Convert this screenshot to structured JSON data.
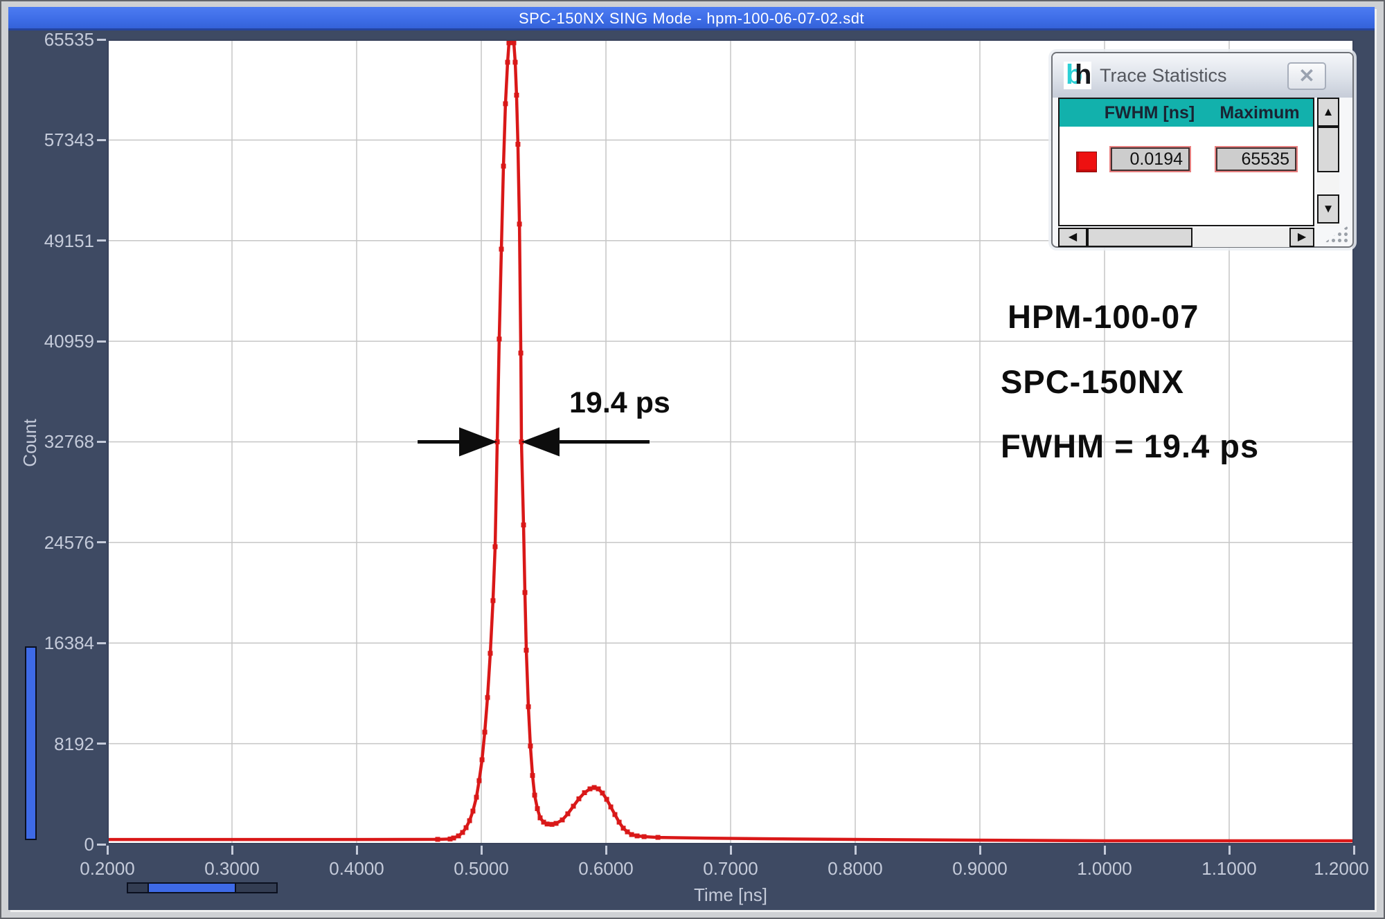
{
  "window": {
    "title": "SPC-150NX  SING Mode - hpm-100-06-07-02.sdt"
  },
  "chart_data": {
    "type": "line",
    "title": "",
    "xlabel": "Time [ns]",
    "ylabel": "Count",
    "xlim": [
      0.2,
      1.2
    ],
    "ylim": [
      0,
      65535
    ],
    "grid": true,
    "x_tick_labels": [
      "0.2000",
      "0.3000",
      "0.4000",
      "0.5000",
      "0.6000",
      "0.7000",
      "0.8000",
      "0.9000",
      "1.0000",
      "1.1000",
      "1.2000"
    ],
    "y_tick_labels": [
      "0",
      "8192",
      "16384",
      "24576",
      "32768",
      "40959",
      "49151",
      "57343",
      "65535"
    ],
    "series": [
      {
        "name": "detector-irf-trace",
        "color": "#d91818",
        "points": [
          [
            0.2,
            390
          ],
          [
            0.25,
            390
          ],
          [
            0.3,
            390
          ],
          [
            0.35,
            390
          ],
          [
            0.4,
            390
          ],
          [
            0.44,
            395
          ],
          [
            0.465,
            400
          ],
          [
            0.475,
            430
          ],
          [
            0.4778,
            510
          ],
          [
            0.4817,
            680
          ],
          [
            0.485,
            960
          ],
          [
            0.4878,
            1350
          ],
          [
            0.4906,
            1920
          ],
          [
            0.4933,
            2700
          ],
          [
            0.4961,
            3830
          ],
          [
            0.4983,
            5180
          ],
          [
            0.5006,
            6880
          ],
          [
            0.5028,
            9130
          ],
          [
            0.505,
            11950
          ],
          [
            0.5072,
            15550
          ],
          [
            0.5094,
            19840
          ],
          [
            0.5111,
            24230
          ],
          [
            0.5128,
            32770
          ],
          [
            0.5144,
            41140
          ],
          [
            0.5161,
            48460
          ],
          [
            0.5178,
            55220
          ],
          [
            0.5194,
            60300
          ],
          [
            0.5211,
            63680
          ],
          [
            0.5222,
            65260
          ],
          [
            0.5233,
            65535
          ],
          [
            0.525,
            65535
          ],
          [
            0.5261,
            65260
          ],
          [
            0.5272,
            63680
          ],
          [
            0.5283,
            61000
          ],
          [
            0.5294,
            57000
          ],
          [
            0.5306,
            50500
          ],
          [
            0.5317,
            40000
          ],
          [
            0.5322,
            32770
          ],
          [
            0.5339,
            26000
          ],
          [
            0.535,
            20500
          ],
          [
            0.5361,
            15800
          ],
          [
            0.5378,
            11200
          ],
          [
            0.5394,
            8000
          ],
          [
            0.5411,
            5600
          ],
          [
            0.5428,
            4000
          ],
          [
            0.545,
            2900
          ],
          [
            0.5472,
            2150
          ],
          [
            0.55,
            1800
          ],
          [
            0.5528,
            1650
          ],
          [
            0.5567,
            1620
          ],
          [
            0.56,
            1700
          ],
          [
            0.565,
            1980
          ],
          [
            0.5694,
            2480
          ],
          [
            0.5739,
            3100
          ],
          [
            0.5783,
            3700
          ],
          [
            0.5828,
            4200
          ],
          [
            0.5872,
            4510
          ],
          [
            0.5906,
            4620
          ],
          [
            0.5939,
            4510
          ],
          [
            0.5972,
            4170
          ],
          [
            0.6006,
            3660
          ],
          [
            0.6039,
            3040
          ],
          [
            0.6072,
            2420
          ],
          [
            0.6106,
            1800
          ],
          [
            0.6139,
            1310
          ],
          [
            0.6172,
            1010
          ],
          [
            0.6206,
            790
          ],
          [
            0.625,
            680
          ],
          [
            0.6306,
            620
          ],
          [
            0.6417,
            560
          ],
          [
            0.6694,
            510
          ],
          [
            0.725,
            450
          ],
          [
            0.8083,
            390
          ],
          [
            0.8917,
            340
          ],
          [
            1.0028,
            280
          ],
          [
            1.1139,
            280
          ],
          [
            1.1989,
            280
          ]
        ]
      }
    ],
    "annotations": {
      "fwhm_label": "19.4 ps",
      "fwhm_level": 32768,
      "fwhm_t1": 0.5128,
      "fwhm_t2": 0.5322
    }
  },
  "side_text": {
    "line1": "HPM-100-07",
    "line2": "SPC-150NX",
    "line3": "FWHM = 19.4 ps"
  },
  "trace_statistics": {
    "title": "Trace Statistics",
    "logo": {
      "b": "b",
      "h": "h"
    },
    "icons": {
      "close": "✕",
      "scroll_up": "▲",
      "scroll_down": "▼",
      "scroll_left": "◀",
      "scroll_right": "▶"
    },
    "columns": [
      "FWHM [ns]",
      "Maximum"
    ],
    "row": {
      "swatch_color": "#ee1111",
      "fwhm": "0.0194",
      "maximum": "65535"
    }
  }
}
